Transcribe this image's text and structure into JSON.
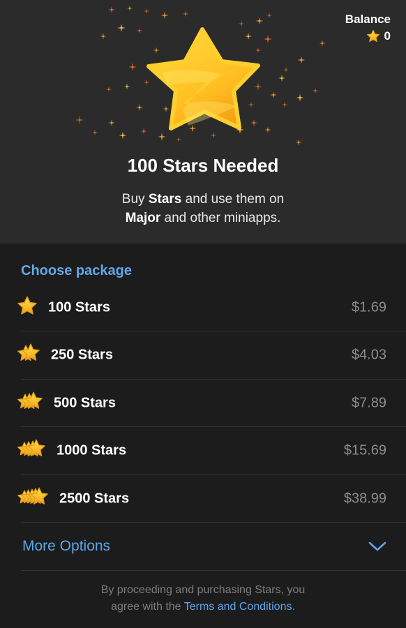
{
  "header": {
    "balance_label": "Balance",
    "balance_value": "0",
    "headline": "100 Stars Needed",
    "sub_buy": "Buy ",
    "sub_stars": "Stars",
    "sub_use": " and use them on",
    "sub_major": "Major",
    "sub_rest": " and other miniapps."
  },
  "packages": {
    "title": "Choose package",
    "items": [
      {
        "label": "100 Stars",
        "price": "$1.69"
      },
      {
        "label": "250 Stars",
        "price": "$4.03"
      },
      {
        "label": "500 Stars",
        "price": "$7.89"
      },
      {
        "label": "1000 Stars",
        "price": "$15.69"
      },
      {
        "label": "2500 Stars",
        "price": "$38.99"
      }
    ],
    "more_label": "More Options"
  },
  "legal": {
    "line1": "By proceeding and purchasing Stars, you",
    "line2_prefix": "agree with the ",
    "link": "Terms and Conditions",
    "line2_suffix": "."
  },
  "colors": {
    "accent": "#5ea6e9",
    "star_gold": "#f7b52a",
    "top_bg": "#2b2b2b",
    "list_bg": "#1c1c1d"
  },
  "icons": [
    "star-icon",
    "chevron-down-icon",
    "sparkle-icon"
  ]
}
